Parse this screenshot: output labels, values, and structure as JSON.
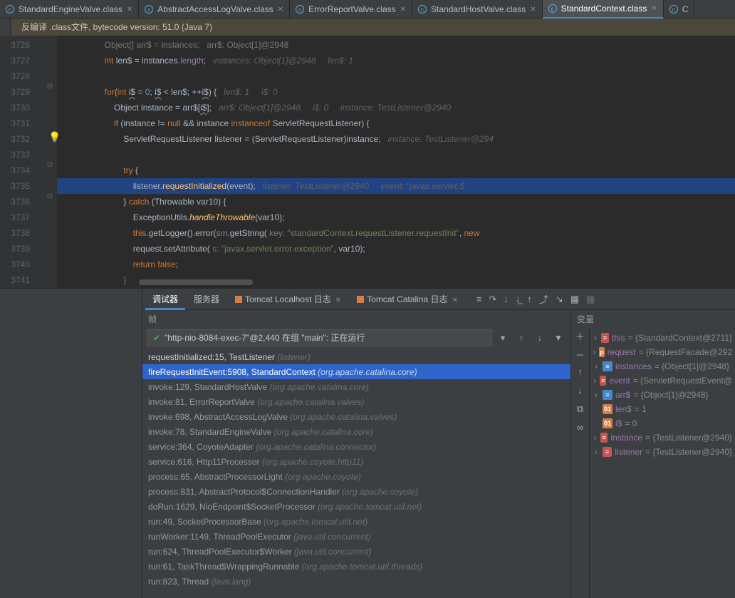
{
  "tabs": [
    {
      "label": "StandardEngineValve.class"
    },
    {
      "label": "AbstractAccessLogValve.class"
    },
    {
      "label": "ErrorReportValve.class"
    },
    {
      "label": "StandardHostValve.class"
    },
    {
      "label": "StandardContext.class"
    },
    {
      "label": "C"
    }
  ],
  "banner": "反编译 .class文件, bytecode version: 51.0 (Java 7)",
  "lines": [
    "3726",
    "3727",
    "3728",
    "3729",
    "3730",
    "3731",
    "3732",
    "3733",
    "3734",
    "3735",
    "3736",
    "3737",
    "3738",
    "3739",
    "3740",
    "3741"
  ],
  "code": {
    "l3726": "        Object[] arr$ = instances;   arr$: Object[1]@2948",
    "l3727_a": "int",
    "l3727_b": " len$ = instances.",
    "l3727_c": "length",
    "l3727_d": ";   ",
    "l3727_hint": "instances: Object[1]@2948     len$: 1",
    "l3729_a": "for",
    "l3729_b": "(",
    "l3729_c": "int ",
    "l3729_d": "i$",
    "l3729_e": " = ",
    "l3729_f": "0",
    "l3729_g": "; ",
    "l3729_h": "i$",
    "l3729_i": " < len$; ++",
    "l3729_j": "i$",
    "l3729_k": ") {   ",
    "l3729_hint": "len$: 1     i$: 0",
    "l3730_a": "Object instance = arr$[",
    "l3730_b": "i$",
    "l3730_c": "];   ",
    "l3730_hint": "arr$: Object[1]@2948     i$: 0     instance: TestListener@2940",
    "l3731_a": "if ",
    "l3731_b": "(instance != ",
    "l3731_c": "null ",
    "l3731_d": "&& instance ",
    "l3731_e": "instanceof ",
    "l3731_f": "ServletRequestListener) {",
    "l3732_a": "ServletRequestListener listener = (ServletRequestListener)instance;   ",
    "l3732_hint": "instance: TestListener@294",
    "l3734_a": "try ",
    "l3734_b": "{",
    "l3735_a": "listener.",
    "l3735_b": "requestInitialized",
    "l3735_c": "(event);   ",
    "l3735_hint": "listener: TestListener@2940     event: \"javax.servlet.S",
    "l3736_a": "} ",
    "l3736_b": "catch ",
    "l3736_c": "(Throwable var10) {",
    "l3737_a": "ExceptionUtils.",
    "l3737_b": "handleThrowable",
    "l3737_c": "(var10);",
    "l3738_a": "this",
    "l3738_b": ".getLogger().error(",
    "l3738_c": "sm",
    "l3738_d": ".getString( ",
    "l3738_key": "key: ",
    "l3738_e": "\"standardContext.requestListener.requestInit\"",
    "l3738_f": ", ",
    "l3738_g": "new",
    "l3739_a": "request.setAttribute( ",
    "l3739_key": "s: ",
    "l3739_b": "\"javax.servlet.error.exception\"",
    "l3739_c": ", var10);",
    "l3740_a": "return false",
    "l3740_b": ";",
    "l3741": "}"
  },
  "debug_tabs": {
    "debugger": "调试器",
    "server": "服务器",
    "log1": "Tomcat Localhost 日志",
    "log2": "Tomcat Catalina 日志"
  },
  "frames_title": "帧",
  "vars_title": "变量",
  "thread": "\"http-nio-8084-exec-7\"@2,440 在组 \"main\": 正在运行",
  "frames": [
    {
      "main": "requestInitialized:15, TestListener ",
      "pkg": "(listener)",
      "top": true
    },
    {
      "main": "fireRequestInitEvent:5908, StandardContext ",
      "pkg": "(org.apache.catalina.core)",
      "sel": true
    },
    {
      "main": "invoke:129, StandardHostValve ",
      "pkg": "(org.apache.catalina.core)"
    },
    {
      "main": "invoke:81, ErrorReportValve ",
      "pkg": "(org.apache.catalina.valves)"
    },
    {
      "main": "invoke:698, AbstractAccessLogValve ",
      "pkg": "(org.apache.catalina.valves)"
    },
    {
      "main": "invoke:78, StandardEngineValve ",
      "pkg": "(org.apache.catalina.core)"
    },
    {
      "main": "service:364, CoyoteAdapter ",
      "pkg": "(org.apache.catalina.connector)"
    },
    {
      "main": "service:616, Http11Processor ",
      "pkg": "(org.apache.coyote.http11)"
    },
    {
      "main": "process:65, AbstractProcessorLight ",
      "pkg": "(org.apache.coyote)"
    },
    {
      "main": "process:831, AbstractProtocol$ConnectionHandler ",
      "pkg": "(org.apache.coyote)"
    },
    {
      "main": "doRun:1629, NioEndpoint$SocketProcessor ",
      "pkg": "(org.apache.tomcat.util.net)"
    },
    {
      "main": "run:49, SocketProcessorBase ",
      "pkg": "(org.apache.tomcat.util.net)"
    },
    {
      "main": "runWorker:1149, ThreadPoolExecutor ",
      "pkg": "(java.util.concurrent)"
    },
    {
      "main": "run:624, ThreadPoolExecutor$Worker ",
      "pkg": "(java.util.concurrent)"
    },
    {
      "main": "run:61, TaskThread$WrappingRunnable ",
      "pkg": "(org.apache.tomcat.util.threads)"
    },
    {
      "main": "run:823, Thread ",
      "pkg": "(java.lang)"
    }
  ],
  "vars": [
    {
      "chev": "›",
      "icon": "≡",
      "cls": "vi-e",
      "name": "this",
      "val": "= {StandardContext@2711}"
    },
    {
      "chev": "›",
      "icon": "p",
      "cls": "vi-p",
      "name": "request",
      "val": "= {RequestFacade@292"
    },
    {
      "chev": "›",
      "icon": "≡",
      "cls": "vi-obj",
      "name": "instances",
      "val": "= {Object[1]@2948}"
    },
    {
      "chev": "›",
      "icon": "≡",
      "cls": "vi-e",
      "name": "event",
      "val": "= {ServletRequestEvent@"
    },
    {
      "chev": "›",
      "icon": "≡",
      "cls": "vi-obj",
      "name": "arr$",
      "val": "= {Object[1]@2948}"
    },
    {
      "chev": " ",
      "icon": "01",
      "cls": "vi-prim",
      "name": "len$",
      "val": "= 1"
    },
    {
      "chev": " ",
      "icon": "01",
      "cls": "vi-prim",
      "name": "i$",
      "val": "= 0"
    },
    {
      "chev": "›",
      "icon": "≡",
      "cls": "vi-e",
      "name": "instance",
      "val": "= {TestListener@2940}"
    },
    {
      "chev": "›",
      "icon": "≡",
      "cls": "vi-e",
      "name": "listener",
      "val": "= {TestListener@2940}"
    }
  ]
}
